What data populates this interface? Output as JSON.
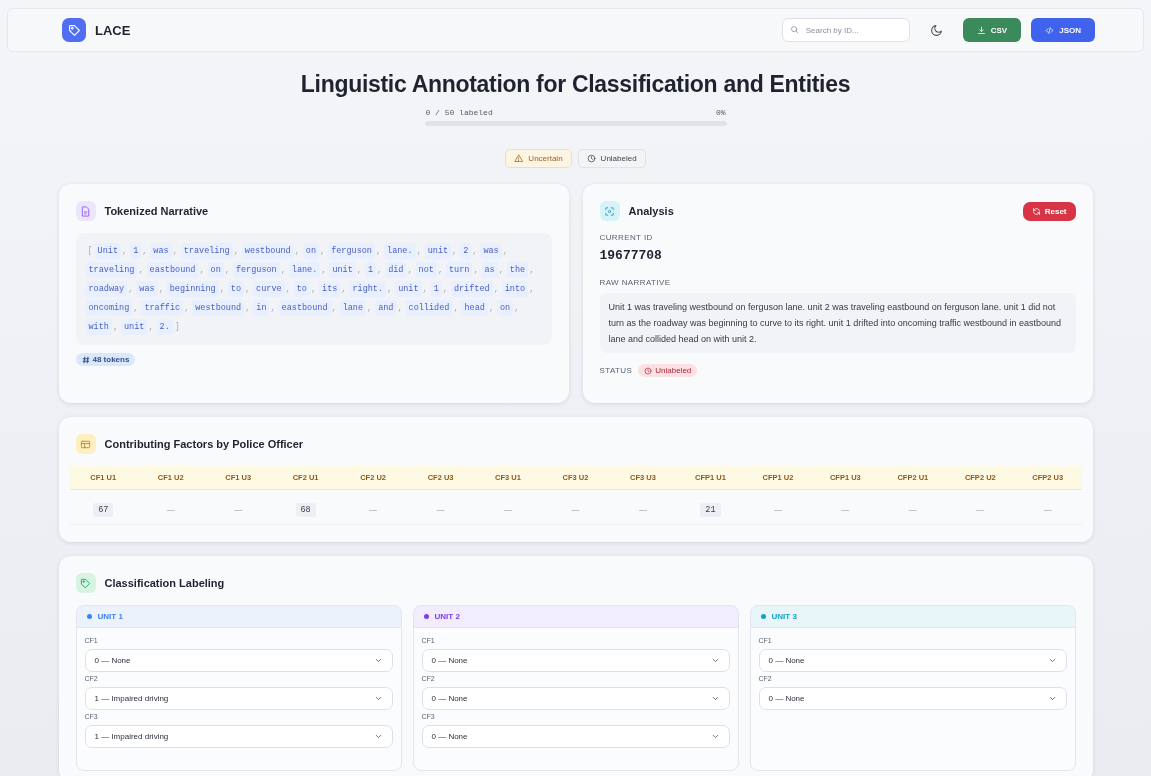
{
  "header": {
    "app_name": "LACE",
    "search": {
      "placeholder": "Search by ID..."
    },
    "buttons": [
      {
        "label": "CSV",
        "kind": "csv"
      },
      {
        "label": "JSON",
        "kind": "json"
      }
    ]
  },
  "title": "Linguistic Annotation for Classification and Entities",
  "progress": {
    "label": "0 / 50 labeled",
    "percent": "0%",
    "level": 0
  },
  "filters": [
    {
      "label": "Uncertain",
      "kind": "uncertain"
    },
    {
      "label": "Unlabeled",
      "kind": "unlabeled"
    }
  ],
  "tokenized_narrative": {
    "title": "Tokenized Narrative",
    "open": "[",
    "close": "]",
    "separator": ",",
    "tokens": [
      "Unit",
      "1",
      "was",
      "traveling",
      "westbound",
      "on",
      "ferguson",
      "lane.",
      "unit",
      "2",
      "was",
      "traveling",
      "eastbound",
      "on",
      "ferguson",
      "lane.",
      "unit",
      "1",
      "did",
      "not",
      "turn",
      "as",
      "the",
      "roadway",
      "was",
      "beginning",
      "to",
      "curve",
      "to",
      "its",
      "right.",
      "unit",
      "1",
      "drifted",
      "into",
      "oncoming",
      "traffic",
      "westbound",
      "in",
      "eastbound",
      "lane",
      "and",
      "collided",
      "head",
      "on",
      "with",
      "unit",
      "2."
    ],
    "count": "48 tokens"
  },
  "analysis": {
    "title": "Analysis",
    "reset": "Reset",
    "id_label": "CURRENT ID",
    "id": "19677708",
    "narrative_label": "RAW NARRATIVE",
    "narrative": "Unit 1 was traveling westbound on ferguson lane. unit 2 was traveling eastbound on ferguson lane. unit 1 did not turn as the roadway was beginning to curve to its right. unit 1 drifted into oncoming traffic westbound in eastbound lane and collided head on with unit 2.",
    "status_label": "STATUS",
    "status": {
      "label": "Unlabeled",
      "kind": "unlabeled"
    }
  },
  "contributing_factors": {
    "title": "Contributing Factors by Police Officer",
    "columns": [
      "CF1 U1",
      "CF1 U2",
      "CF1 U3",
      "CF2 U1",
      "CF2 U2",
      "CF2 U3",
      "CF3 U1",
      "CF3 U2",
      "CF3 U3",
      "CFP1 U1",
      "CFP1 U2",
      "CFP1 U3",
      "CFP2 U1",
      "CFP2 U2",
      "CFP2 U3"
    ],
    "row": [
      {
        "value": "67",
        "kind": "number"
      },
      {
        "value": "—",
        "kind": "blank"
      },
      {
        "value": "—",
        "kind": "blank"
      },
      {
        "value": "68",
        "kind": "number"
      },
      {
        "value": "—",
        "kind": "blank"
      },
      {
        "value": "—",
        "kind": "blank"
      },
      {
        "value": "—",
        "kind": "blank"
      },
      {
        "value": "—",
        "kind": "blank"
      },
      {
        "value": "—",
        "kind": "blank"
      },
      {
        "value": "21",
        "kind": "number"
      },
      {
        "value": "—",
        "kind": "blank"
      },
      {
        "value": "—",
        "kind": "blank"
      },
      {
        "value": "—",
        "kind": "blank"
      },
      {
        "value": "—",
        "kind": "blank"
      },
      {
        "value": "—",
        "kind": "blank"
      }
    ]
  },
  "classification": {
    "title": "Classification Labeling",
    "units": [
      {
        "name": "UNIT 1",
        "color": "#3b82f6",
        "fields": [
          {
            "label": "CF1",
            "value": "0 — None"
          },
          {
            "label": "CF2",
            "value": "1 — Impaired driving"
          },
          {
            "label": "CF3",
            "value": "1 — Impaired driving"
          }
        ]
      },
      {
        "name": "UNIT 2",
        "color": "#7c3aed",
        "fields": [
          {
            "label": "CF1",
            "value": "0 — None"
          },
          {
            "label": "CF2",
            "value": "0 — None"
          },
          {
            "label": "CF3",
            "value": "0 — None"
          }
        ]
      },
      {
        "name": "UNIT 3",
        "color": "#0ea5c6",
        "fields": [
          {
            "label": "CF1",
            "value": "0 — None"
          },
          {
            "label": "CF2",
            "value": "0 — None"
          }
        ]
      }
    ]
  }
}
